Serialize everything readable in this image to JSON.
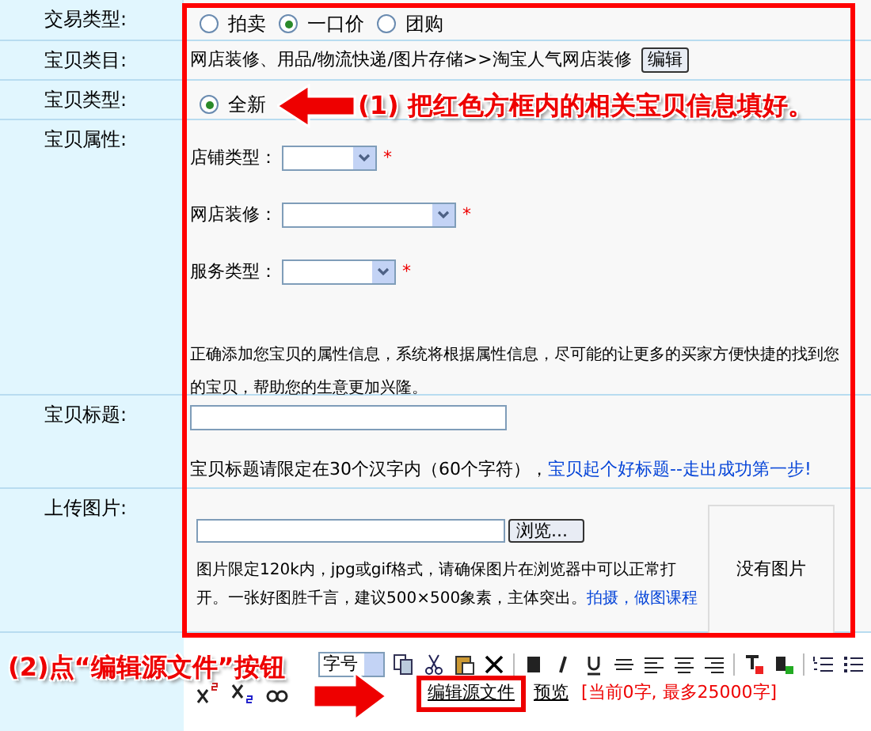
{
  "rows": [
    {
      "kind": "radios",
      "label": "交易类型:",
      "options": [
        {
          "label": "拍卖",
          "selected": false
        },
        {
          "label": "一口价",
          "selected": true
        },
        {
          "label": "团购",
          "selected": false
        }
      ]
    },
    {
      "kind": "category",
      "label": "宝贝类目:",
      "path": "网店装修、用品/物流快递/图片存储>>淘宝人气网店装修",
      "button": "编辑"
    },
    {
      "kind": "radios",
      "label": "宝贝类型:",
      "options": [
        {
          "label": "全新",
          "selected": true
        }
      ]
    },
    {
      "kind": "attributes",
      "label": "宝贝属性:",
      "fields": [
        {
          "label": "店铺类型",
          "separator": "：",
          "required": "*"
        },
        {
          "label": "网店装修",
          "separator": "：",
          "required": "*"
        },
        {
          "label": "服务类型",
          "separator": "：",
          "required": "*"
        }
      ],
      "note": "正确添加您宝贝的属性信息，系统将根据属性信息，尽可能的让更多的买家方便快捷的找到您的宝贝，帮助您的生意更加兴隆。"
    },
    {
      "kind": "title",
      "label": "宝贝标题:",
      "note": "宝贝标题请限定在30个汉字内（60个字符），",
      "link": "宝贝起个好标题--走出成功第一步!"
    },
    {
      "kind": "upload",
      "label": "上传图片:",
      "button": "浏览...",
      "note": "图片限定120k内，jpg或gif格式，请确保图片在浏览器中可以正常打开。一张好图胜千言，建议500×500象素，主体突出。",
      "link": "拍摄，做图课程",
      "preview": "没有图片"
    }
  ],
  "editor": {
    "font_size": "字号",
    "source_button": "编辑源文件",
    "preview": "预览",
    "counter": "[当前0字, 最多25000字]"
  },
  "annotations": [
    "(1) 把红色方框内的相关宝贝信息填好。",
    "(2)点“编辑源文件”按钮"
  ]
}
